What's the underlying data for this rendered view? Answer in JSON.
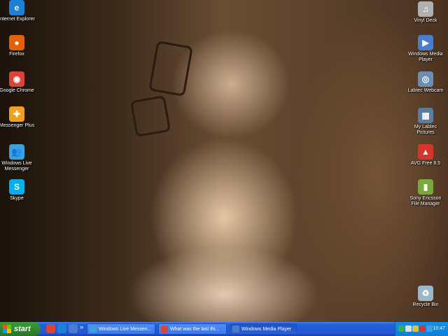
{
  "desktop": {
    "icons_left": [
      {
        "label": "Internet Explorer",
        "icon": "internet-explorer-icon",
        "color": "#1d7fd6",
        "glyph": "e"
      },
      {
        "label": "Firefox",
        "icon": "firefox-icon",
        "color": "#e66000",
        "glyph": "●"
      },
      {
        "label": "Google Chrome",
        "icon": "chrome-icon",
        "color": "#db4437",
        "glyph": "◉"
      },
      {
        "label": "Messenger Plus",
        "icon": "messenger-plus-icon",
        "color": "#f0a020",
        "glyph": "✚"
      },
      {
        "label": "Windows Live Messenger",
        "icon": "windows-live-messenger-icon",
        "color": "#3aa0e0",
        "glyph": "👥"
      },
      {
        "label": "Skype",
        "icon": "skype-icon",
        "color": "#00aff0",
        "glyph": "S"
      }
    ],
    "icons_right": [
      {
        "label": "Vinyl Deck",
        "icon": "vinyl-deck-icon",
        "color": "#b0b0b0",
        "glyph": "♫"
      },
      {
        "label": "Windows Media Player",
        "icon": "windows-media-player-icon",
        "color": "#4a7cc9",
        "glyph": "▶"
      },
      {
        "label": "Labtec Webcam",
        "icon": "webcam-icon",
        "color": "#6a8fb0",
        "glyph": "◎"
      },
      {
        "label": "My Labtec Pictures",
        "icon": "pictures-icon",
        "color": "#5a7da0",
        "glyph": "▦"
      },
      {
        "label": "AVG Free 8.5",
        "icon": "avg-icon",
        "color": "#d9342b",
        "glyph": "▲"
      },
      {
        "label": "Sony Ericsson File Manager",
        "icon": "file-manager-icon",
        "color": "#7aa83a",
        "glyph": "▮"
      },
      {
        "label": "Recycle Bin",
        "icon": "recycle-bin-icon",
        "color": "#9ab8c8",
        "glyph": "♻"
      }
    ]
  },
  "taskbar": {
    "start_label": "start",
    "quick_launch": [
      {
        "icon": "chrome-icon",
        "color": "#db4437"
      },
      {
        "icon": "internet-explorer-icon",
        "color": "#1d7fd6"
      },
      {
        "icon": "windows-media-player-icon",
        "color": "#4a7cc9"
      }
    ],
    "overflow": "»",
    "tasks": [
      {
        "label": "Windows Live Messen...",
        "icon": "windows-live-messenger-icon",
        "color": "#3aa0e0"
      },
      {
        "label": "What was the last thi...",
        "icon": "chrome-icon",
        "color": "#db4437"
      },
      {
        "label": "Windows Media Player",
        "icon": "windows-media-player-icon",
        "color": "#4a7cc9"
      }
    ],
    "tray_icons": [
      {
        "icon": "network-icon",
        "color": "#3cb043"
      },
      {
        "icon": "volume-icon",
        "color": "#e0e0e0"
      },
      {
        "icon": "shield-icon",
        "color": "#e8c020"
      },
      {
        "icon": "antivirus-icon",
        "color": "#d9342b"
      },
      {
        "icon": "messenger-tray-icon",
        "color": "#3aa0e0"
      }
    ],
    "clock": "10:47"
  }
}
